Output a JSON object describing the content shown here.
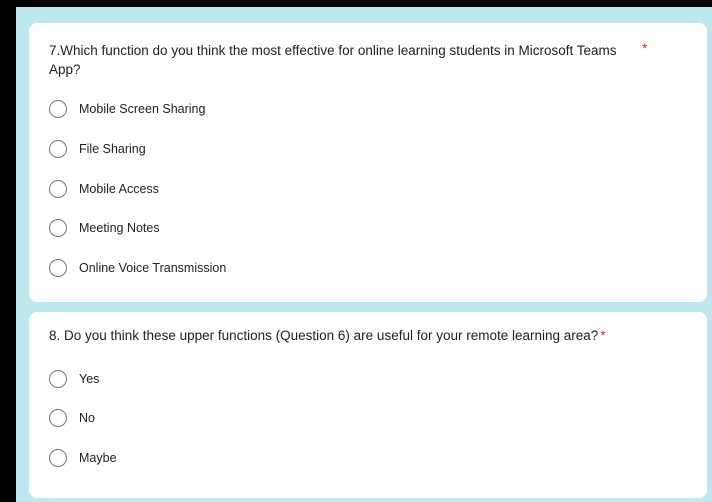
{
  "questions": [
    {
      "text": "7.Which function do you think the most effective for online learning students in Microsoft Teams App?",
      "required_mark": "*",
      "options": [
        {
          "label": "Mobile Screen Sharing",
          "selected": false
        },
        {
          "label": "File Sharing",
          "selected": false
        },
        {
          "label": "Mobile Access",
          "selected": false
        },
        {
          "label": "Meeting Notes",
          "selected": false
        },
        {
          "label": "Online Voice Transmission",
          "selected": false
        }
      ]
    },
    {
      "text": "8. Do you think these upper  functions (Question 6) are useful for your remote learning area?",
      "required_mark": "*",
      "options": [
        {
          "label": "Yes",
          "selected": false
        },
        {
          "label": "No",
          "selected": false
        },
        {
          "label": "Maybe",
          "selected": false
        }
      ]
    }
  ],
  "colors": {
    "page_background": "#bfe7ef",
    "card_background": "#ffffff",
    "required_mark": "#d93025",
    "radio_border": "#757575",
    "outer_frame": "#000000"
  }
}
